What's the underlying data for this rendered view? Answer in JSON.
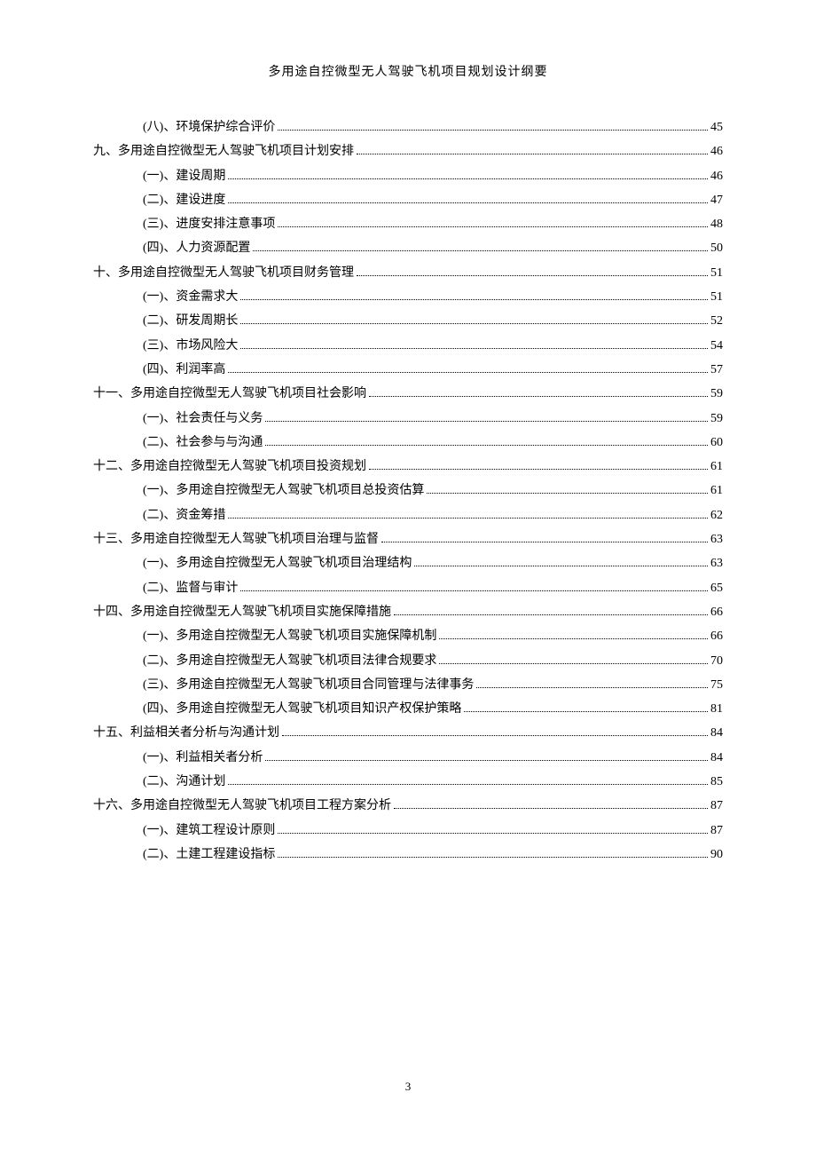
{
  "header_title": "多用途自控微型无人驾驶飞机项目规划设计纲要",
  "page_number": "3",
  "toc_entries": [
    {
      "level": 2,
      "label": "(八)、环境保护综合评价",
      "page": "45"
    },
    {
      "level": 1,
      "label": "九、多用途自控微型无人驾驶飞机项目计划安排",
      "page": "46"
    },
    {
      "level": 2,
      "label": "(一)、建设周期",
      "page": "46"
    },
    {
      "level": 2,
      "label": "(二)、建设进度",
      "page": "47"
    },
    {
      "level": 2,
      "label": "(三)、进度安排注意事项",
      "page": "48"
    },
    {
      "level": 2,
      "label": "(四)、人力资源配置",
      "page": "50"
    },
    {
      "level": 1,
      "label": "十、多用途自控微型无人驾驶飞机项目财务管理",
      "page": "51"
    },
    {
      "level": 2,
      "label": "(一)、资金需求大",
      "page": "51"
    },
    {
      "level": 2,
      "label": "(二)、研发周期长",
      "page": "52"
    },
    {
      "level": 2,
      "label": "(三)、市场风险大",
      "page": "54"
    },
    {
      "level": 2,
      "label": "(四)、利润率高",
      "page": "57"
    },
    {
      "level": 1,
      "label": "十一、多用途自控微型无人驾驶飞机项目社会影响",
      "page": "59"
    },
    {
      "level": 2,
      "label": "(一)、社会责任与义务",
      "page": "59"
    },
    {
      "level": 2,
      "label": "(二)、社会参与与沟通",
      "page": "60"
    },
    {
      "level": 1,
      "label": "十二、多用途自控微型无人驾驶飞机项目投资规划",
      "page": "61"
    },
    {
      "level": 2,
      "label": "(一)、多用途自控微型无人驾驶飞机项目总投资估算",
      "page": "61"
    },
    {
      "level": 2,
      "label": "(二)、资金筹措",
      "page": "62"
    },
    {
      "level": 1,
      "label": "十三、多用途自控微型无人驾驶飞机项目治理与监督",
      "page": "63"
    },
    {
      "level": 2,
      "label": "(一)、多用途自控微型无人驾驶飞机项目治理结构",
      "page": "63"
    },
    {
      "level": 2,
      "label": "(二)、监督与审计",
      "page": "65"
    },
    {
      "level": 1,
      "label": "十四、多用途自控微型无人驾驶飞机项目实施保障措施",
      "page": "66"
    },
    {
      "level": 2,
      "label": "(一)、多用途自控微型无人驾驶飞机项目实施保障机制",
      "page": "66"
    },
    {
      "level": 2,
      "label": "(二)、多用途自控微型无人驾驶飞机项目法律合规要求",
      "page": "70"
    },
    {
      "level": 2,
      "label": "(三)、多用途自控微型无人驾驶飞机项目合同管理与法律事务",
      "page": "75"
    },
    {
      "level": 2,
      "label": "(四)、多用途自控微型无人驾驶飞机项目知识产权保护策略",
      "page": "81"
    },
    {
      "level": 1,
      "label": "十五、利益相关者分析与沟通计划",
      "page": "84"
    },
    {
      "level": 2,
      "label": "(一)、利益相关者分析",
      "page": "84"
    },
    {
      "level": 2,
      "label": "(二)、沟通计划",
      "page": "85"
    },
    {
      "level": 1,
      "label": "十六、多用途自控微型无人驾驶飞机项目工程方案分析",
      "page": "87"
    },
    {
      "level": 2,
      "label": "(一)、建筑工程设计原则",
      "page": "87"
    },
    {
      "level": 2,
      "label": "(二)、土建工程建设指标",
      "page": "90"
    }
  ]
}
